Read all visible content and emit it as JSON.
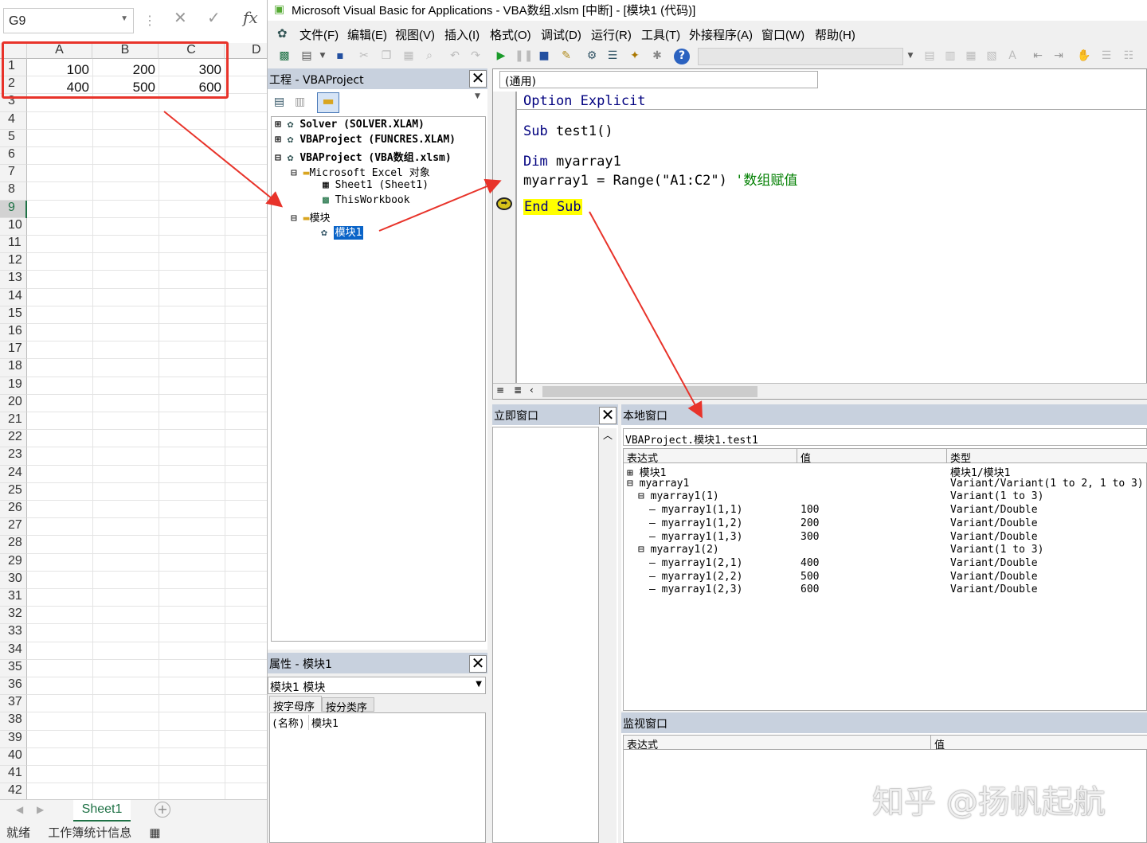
{
  "excel": {
    "namebox": "G9",
    "fx_label": "fx",
    "columns": [
      "A",
      "B",
      "C",
      "D"
    ],
    "rows": [
      "1",
      "2",
      "3",
      "4",
      "5",
      "6",
      "7",
      "8",
      "9",
      "10",
      "11",
      "12",
      "13",
      "14",
      "15",
      "16",
      "17",
      "18",
      "19",
      "20",
      "21",
      "22",
      "23",
      "24",
      "25",
      "26",
      "27",
      "28",
      "29",
      "30",
      "31",
      "32",
      "33",
      "34",
      "35",
      "36",
      "37",
      "38",
      "39",
      "40",
      "41",
      "42"
    ],
    "cells": [
      [
        "100",
        "200",
        "300"
      ],
      [
        "400",
        "500",
        "600"
      ]
    ],
    "sheet_tab": "Sheet1",
    "status_ready": "就绪",
    "status_stats": "工作簿统计信息"
  },
  "vbe": {
    "title": "Microsoft Visual Basic for Applications - VBA数组.xlsm [中断] - [模块1 (代码)]",
    "menu": [
      "文件(F)",
      "编辑(E)",
      "视图(V)",
      "插入(I)",
      "格式(O)",
      "调试(D)",
      "运行(R)",
      "工具(T)",
      "外接程序(A)",
      "窗口(W)",
      "帮助(H)"
    ],
    "project": {
      "header": "工程 - VBAProject",
      "tree": [
        "Solver (SOLVER.XLAM)",
        "VBAProject (FUNCRES.XLAM)",
        "VBAProject (VBA数组.xlsm)",
        "Microsoft Excel 对象",
        "Sheet1 (Sheet1)",
        "ThisWorkbook",
        "模块",
        "模块1"
      ]
    },
    "properties": {
      "header": "属性 - 模块1",
      "object": "模块1 模块",
      "tab_alpha": "按字母序",
      "tab_cat": "按分类序",
      "name_key": "(名称)",
      "name_val": "模块1"
    },
    "code": {
      "proc": "(通用)",
      "line1": "Option Explicit",
      "line2": "Sub test1()",
      "line3": "Dim myarray1",
      "line4a": "myarray1 = Range(\"A1:C2\") ",
      "line4b": "'数组赋值",
      "line5": "End Sub"
    },
    "immediate": {
      "header": "立即窗口"
    },
    "locals": {
      "header": "本地窗口",
      "context": "VBAProject.模块1.test1",
      "col_expr": "表达式",
      "col_val": "值",
      "col_type": "类型",
      "rows": [
        {
          "expr": "模块1",
          "val": "",
          "type": "模块1/模块1"
        },
        {
          "expr": "myarray1",
          "val": "",
          "type": "Variant/Variant(1 to 2, 1 to 3)"
        },
        {
          "expr": "myarray1(1)",
          "val": "",
          "type": "Variant(1 to 3)"
        },
        {
          "expr": "myarray1(1,1)",
          "val": "100",
          "type": "Variant/Double"
        },
        {
          "expr": "myarray1(1,2)",
          "val": "200",
          "type": "Variant/Double"
        },
        {
          "expr": "myarray1(1,3)",
          "val": "300",
          "type": "Variant/Double"
        },
        {
          "expr": "myarray1(2)",
          "val": "",
          "type": "Variant(1 to 3)"
        },
        {
          "expr": "myarray1(2,1)",
          "val": "400",
          "type": "Variant/Double"
        },
        {
          "expr": "myarray1(2,2)",
          "val": "500",
          "type": "Variant/Double"
        },
        {
          "expr": "myarray1(2,3)",
          "val": "600",
          "type": "Variant/Double"
        }
      ]
    },
    "watch": {
      "header": "监视窗口",
      "col_expr": "表达式",
      "col_val": "值"
    }
  },
  "watermark": "知乎 @扬帆起航",
  "colors": {
    "red_annotation": "#e8332a",
    "excel_green": "#1e7145",
    "pane_header": "#c8d1de"
  }
}
